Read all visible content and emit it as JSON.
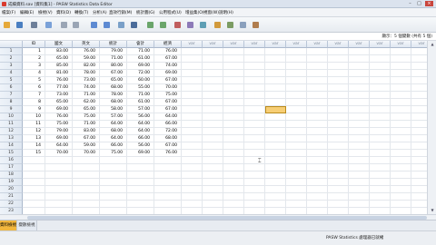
{
  "window": {
    "title": "成績資料.sav [資料集1] - PASW Statistics Data Editor",
    "controls": {
      "minimize": "–",
      "maximize": "□",
      "close": "×"
    }
  },
  "menu": [
    "檔案(F)",
    "編輯(E)",
    "檢視(V)",
    "資料(D)",
    "轉換(T)",
    "分析(A)",
    "直效行銷(M)",
    "統計圖(G)",
    "公用程式(U)",
    "增益集(O)",
    "視窗(W)",
    "說明(H)"
  ],
  "toolbar": {
    "icons": [
      "open-icon",
      "save-icon",
      "print-icon",
      "dialog-recall-icon",
      "undo-icon",
      "redo-icon",
      "goto-case-icon",
      "goto-variable-icon",
      "variables-icon",
      "find-icon",
      "insert-cases-icon",
      "insert-variable-icon",
      "split-file-icon",
      "weight-cases-icon",
      "select-cases-icon",
      "value-labels-icon",
      "use-sets-icon",
      "show-all-icon",
      "spelling-icon"
    ]
  },
  "infobar": {
    "visible": "顯示：5 個變數 (共有 5 個)"
  },
  "grid": {
    "columns": [
      "ID",
      "國文",
      "英文",
      "統計",
      "會計",
      "經濟"
    ],
    "empty_column_label": "var",
    "empty_column_count": 12,
    "total_rows": 23,
    "rows": [
      [
        "1",
        "83.00",
        "76.00",
        "79.00",
        "71.00",
        "76.00"
      ],
      [
        "2",
        "65.00",
        "59.00",
        "71.00",
        "61.00",
        "67.00"
      ],
      [
        "3",
        "85.00",
        "82.00",
        "80.00",
        "69.00",
        "74.00"
      ],
      [
        "4",
        "81.00",
        "78.00",
        "67.00",
        "72.00",
        "69.00"
      ],
      [
        "5",
        "76.00",
        "73.00",
        "65.00",
        "60.00",
        "67.00"
      ],
      [
        "6",
        "77.00",
        "74.00",
        "68.00",
        "55.00",
        "70.00"
      ],
      [
        "7",
        "73.00",
        "71.00",
        "78.00",
        "71.00",
        "75.00"
      ],
      [
        "8",
        "65.00",
        "62.00",
        "68.00",
        "61.00",
        "67.00"
      ],
      [
        "9",
        "69.00",
        "65.00",
        "58.00",
        "57.00",
        "67.00"
      ],
      [
        "10",
        "76.00",
        "75.00",
        "57.00",
        "56.00",
        "64.00"
      ],
      [
        "11",
        "75.00",
        "71.00",
        "64.00",
        "64.00",
        "66.00"
      ],
      [
        "12",
        "79.00",
        "83.00",
        "68.00",
        "64.00",
        "72.00"
      ],
      [
        "13",
        "69.00",
        "67.00",
        "64.00",
        "66.00",
        "68.00"
      ],
      [
        "14",
        "64.00",
        "59.00",
        "66.00",
        "56.00",
        "67.00"
      ],
      [
        "15",
        "70.00",
        "70.00",
        "75.00",
        "69.00",
        "76.00"
      ]
    ]
  },
  "tabs": [
    {
      "label": "資料檢視",
      "active": true
    },
    {
      "label": "變數檢視",
      "active": false
    }
  ],
  "status": "PASW Statistics 處理器已就緒",
  "colors": {
    "active_tab": "#f2b73e",
    "selected_cell": "#f7ce74",
    "header_bg": "#dfe7f1",
    "close_button": "#c9463d"
  }
}
